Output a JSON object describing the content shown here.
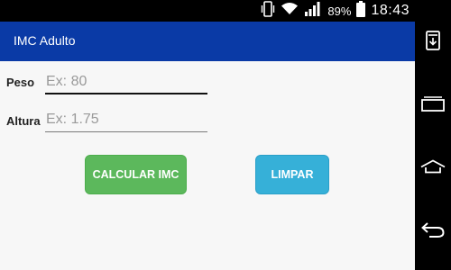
{
  "status_bar": {
    "battery_percent": "89%",
    "time": "18:43",
    "icons": [
      "vibrate-icon",
      "wifi-icon",
      "signal-icon",
      "battery-icon"
    ]
  },
  "app_bar": {
    "title": "IMC Adulto",
    "color": "#0a3aa6"
  },
  "form": {
    "peso": {
      "label": "Peso",
      "placeholder": "Ex: 80",
      "value": ""
    },
    "altura": {
      "label": "Altura",
      "placeholder": "Ex: 1.75",
      "value": ""
    }
  },
  "buttons": {
    "calcular": {
      "label": "CALCULAR IMC",
      "color": "#5cb85c"
    },
    "limpar": {
      "label": "LIMPAR",
      "color": "#36b0d8"
    }
  },
  "nav_bar": {
    "icons": [
      "notification-down-icon",
      "recent-apps-icon",
      "home-icon",
      "back-icon"
    ]
  }
}
